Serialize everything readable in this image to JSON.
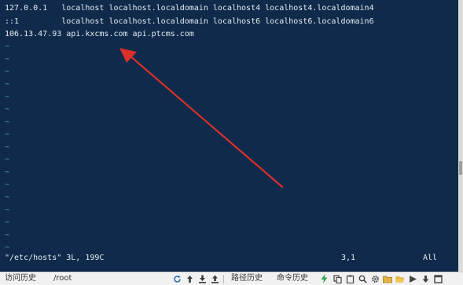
{
  "terminal": {
    "lines": [
      "127.0.0.1   localhost localhost.localdomain localhost4 localhost4.localdomain4",
      "::1         localhost localhost.localdomain localhost6 localhost6.localdomain6",
      "106.13.47.93 api.kxcms.com api.ptcms.com"
    ],
    "tilde": "~",
    "status": {
      "file_info": "\"/etc/hosts\" 3L, 199C",
      "cursor_pos": "3,1",
      "scroll": "All"
    }
  },
  "bottom_bar": {
    "history": "访问历史",
    "path": "/root",
    "path_history": "路径历史",
    "command_history": "命令历史"
  },
  "colors": {
    "terminal_bg": "#0f2a4a",
    "terminal_text": "#e6edf5",
    "tilde": "#4aa3c8",
    "annotation_arrow": "#d9302c"
  },
  "toolbar_icons": [
    "refresh-icon",
    "upload-icon",
    "download-icon",
    "upload-alt-icon",
    "lightning-icon",
    "copy-icon",
    "clipboard-icon",
    "search-icon",
    "gear-icon",
    "folder-icon",
    "send-icon",
    "download-arrow-icon",
    "maximize-icon"
  ]
}
